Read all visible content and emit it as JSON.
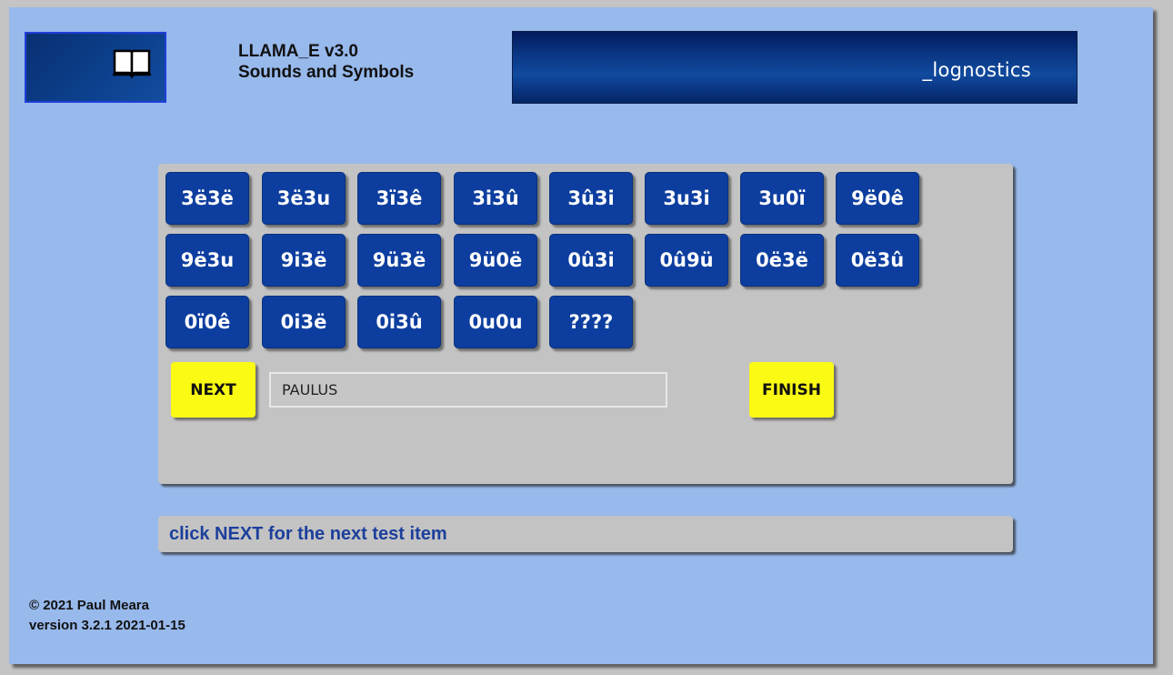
{
  "header": {
    "logo_icon": "open-book-icon",
    "title_line1": "LLAMA_E v3.0",
    "title_line2": "Sounds and Symbols",
    "brand": "_lognostics"
  },
  "symbols": [
    "3ë3ë",
    "3ë3u",
    "3ï3ê",
    "3i3û",
    "3û3i",
    "3u3i",
    "3u0ï",
    "9ë0ê",
    "9ë3u",
    "9i3ë",
    "9ü3ë",
    "9ü0ë",
    "0û3i",
    "0û9ü",
    "0ë3ë",
    "0ë3û",
    "0ï0ê",
    "0i3ë",
    "0i3û",
    "0u0u",
    "????"
  ],
  "controls": {
    "next_label": "NEXT",
    "name_value": "PAULUS",
    "finish_label": "FINISH"
  },
  "status": {
    "message": "click NEXT for the next test item"
  },
  "footer": {
    "copyright": "© 2021 Paul Meara",
    "version": "version 3.2.1 2021-01-15"
  },
  "colors": {
    "background": "#97b9ec",
    "symbol_button": "#0d3e9f",
    "action_button": "#fbfa14",
    "status_text": "#1c3f9c"
  }
}
